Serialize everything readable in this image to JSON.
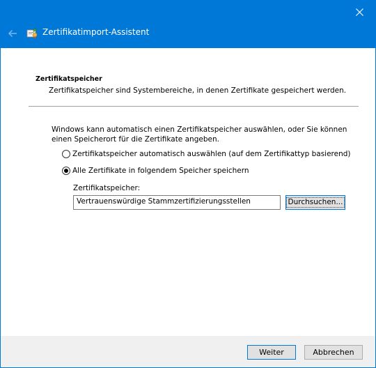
{
  "window": {
    "title": "Zertifikatimport-Assistent",
    "accent_color": "#0078d7",
    "back_icon": "arrow-left-icon",
    "close_icon": "close-icon",
    "app_icon": "certificate-wizard-icon"
  },
  "section": {
    "title": "Zertifikatspeicher",
    "description": "Zertifikatspeicher sind Systembereiche, in denen Zertifikate gespeichert werden."
  },
  "intro": "Windows kann automatisch einen Zertifikatspeicher auswählen, oder Sie können einen Speicherort für die Zertifikate angeben.",
  "options": [
    {
      "label": "Zertifikatspeicher automatisch auswählen (auf dem Zertifikattyp basierend)",
      "selected": false
    },
    {
      "label": "Alle Zertifikate in folgendem Speicher speichern",
      "selected": true
    }
  ],
  "store": {
    "label": "Zertifikatspeicher:",
    "value": "Vertrauenswürdige Stammzertifizierungsstellen",
    "browse_label": "Durchsuchen..."
  },
  "footer": {
    "next_label": "Weiter",
    "cancel_label": "Abbrechen"
  }
}
